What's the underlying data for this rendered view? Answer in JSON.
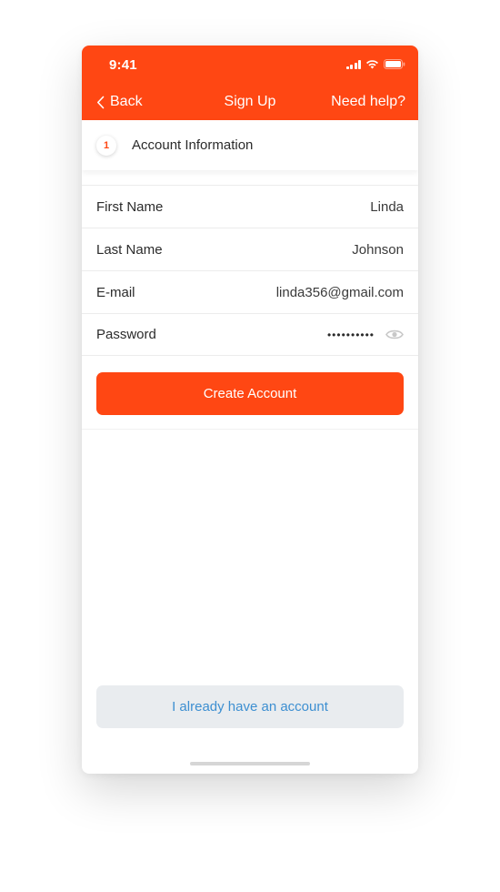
{
  "status_bar": {
    "time": "9:41",
    "icons": [
      "signal-icon",
      "wifi-icon",
      "battery-icon"
    ]
  },
  "nav": {
    "back_label": "Back",
    "back_icon": "chevron-left-icon",
    "title": "Sign Up",
    "help_label": "Need help?"
  },
  "step": {
    "number": "1",
    "label": "Account Information"
  },
  "form": {
    "first_name": {
      "label": "First Name",
      "value": "Linda"
    },
    "last_name": {
      "label": "Last Name",
      "value": "Johnson"
    },
    "email": {
      "label": "E-mail",
      "value": "linda356@gmail.com"
    },
    "password": {
      "label": "Password",
      "masked_value": "••••••••••",
      "toggle_icon": "eye-icon"
    }
  },
  "buttons": {
    "create_account": "Create Account",
    "have_account": "I already have an account"
  },
  "colors": {
    "accent": "#ff4713",
    "link": "#3d8fd1",
    "secondary_button_bg": "#e9ecef"
  }
}
